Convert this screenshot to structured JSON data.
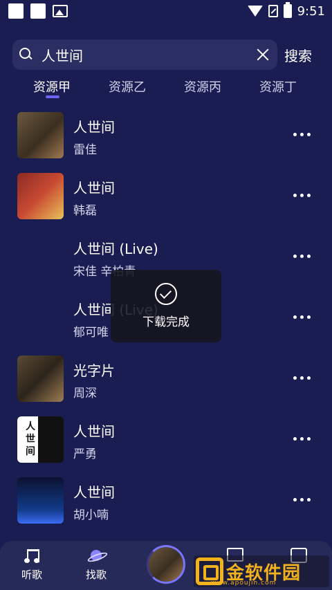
{
  "status_bar": {
    "time": "9:51"
  },
  "search": {
    "value": "人世间",
    "button_label": "搜索"
  },
  "tabs": [
    {
      "label": "资源甲",
      "active": true
    },
    {
      "label": "资源乙",
      "active": false
    },
    {
      "label": "资源丙",
      "active": false
    },
    {
      "label": "资源丁",
      "active": false
    }
  ],
  "songs": [
    {
      "title": "人世间",
      "artist": "雷佳",
      "cover": "c1"
    },
    {
      "title": "人世间",
      "artist": "韩磊",
      "cover": "c2"
    },
    {
      "title": "人世间 (Live)",
      "artist": "宋佳 辛柏青",
      "cover": ""
    },
    {
      "title": "人世间 (Live)",
      "artist": "郁可唯",
      "cover": ""
    },
    {
      "title": "光字片",
      "artist": "周深",
      "cover": "c5"
    },
    {
      "title": "人世间",
      "artist": "严勇",
      "cover": "c6",
      "cover_text": "人世间"
    },
    {
      "title": "人世间",
      "artist": "胡小喃",
      "cover": "c7"
    }
  ],
  "toast": {
    "text": "下载完成"
  },
  "bottom_nav": {
    "listen_label": "听歌",
    "discover_label": "找歌"
  },
  "watermark": {
    "text": "金软件园",
    "url": "www.apoujin.com"
  },
  "colors": {
    "background": "#1a1d52",
    "accent": "#6a63f0",
    "watermark": "#f2b21c"
  }
}
